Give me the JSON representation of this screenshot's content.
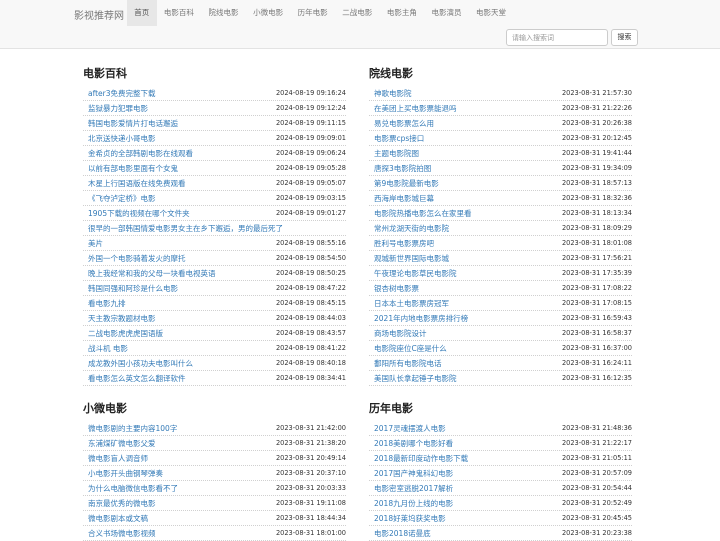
{
  "brand": "影视推荐网",
  "nav": [
    "首页",
    "电影百科",
    "院线电影",
    "小微电影",
    "历年电影",
    "二战电影",
    "电影主角",
    "电影演员",
    "电影天堂"
  ],
  "search": {
    "placeholder": "请输入搜索词",
    "button": "搜索"
  },
  "sections": [
    {
      "title": "电影百科",
      "items": [
        {
          "t": "after3免费完整下载",
          "d": "2024-08-19 09:16:24"
        },
        {
          "t": "监狱暴力犯罪电影",
          "d": "2024-08-19 09:12:24"
        },
        {
          "t": "韩国电影爱情片打电话邂逅",
          "d": "2024-08-19 09:11:15"
        },
        {
          "t": "北京送快递小哥电影",
          "d": "2024-08-19 09:09:01"
        },
        {
          "t": "金希贞的全部韩剧电影在线观看",
          "d": "2024-08-19 09:06:24"
        },
        {
          "t": "以前有部电影里面有个女鬼",
          "d": "2024-08-19 09:05:28"
        },
        {
          "t": "木星上行国语版在线免费观看",
          "d": "2024-08-19 09:05:07"
        },
        {
          "t": "《飞夺泸定桥》电影",
          "d": "2024-08-19 09:03:15"
        },
        {
          "t": "1905下载的视频在哪个文件夹",
          "d": "2024-08-19 09:01:27"
        },
        {
          "t": "很早的一部韩国情爱电影男女主在乡下邂逅，男的最后死了",
          "d": ""
        },
        {
          "t": "美片",
          "d": "2024-08-19 08:55:16"
        },
        {
          "t": "外国一个电影骑着发火的摩托",
          "d": "2024-08-19 08:54:50"
        },
        {
          "t": "晚上我经常和我的父母一块看电视英语",
          "d": "2024-08-19 08:50:25"
        },
        {
          "t": "韩国同强和阿珍是什么电影",
          "d": "2024-08-19 08:47:22"
        },
        {
          "t": "看电影九排",
          "d": "2024-08-19 08:45:15"
        },
        {
          "t": "天主教宗教题材电影",
          "d": "2024-08-19 08:44:03"
        },
        {
          "t": "二战电影虎虎虎国语版",
          "d": "2024-08-19 08:43:57"
        },
        {
          "t": "战斗机 电影",
          "d": "2024-08-19 08:41:22"
        },
        {
          "t": "成龙教外国小孩功夫电影叫什么",
          "d": "2024-08-19 08:40:18"
        },
        {
          "t": "看电影怎么英文怎么翻译软件",
          "d": "2024-08-19 08:34:41"
        }
      ]
    },
    {
      "title": "院线电影",
      "items": [
        {
          "t": "神歌电影院",
          "d": "2023-08-31 21:57:30"
        },
        {
          "t": "在美团上买电影票能退吗",
          "d": "2023-08-31 21:22:26"
        },
        {
          "t": "易兑电影票怎么用",
          "d": "2023-08-31 20:26:38"
        },
        {
          "t": "电影票cps接口",
          "d": "2023-08-31 20:12:45"
        },
        {
          "t": "主题电影院图",
          "d": "2023-08-31 19:41:44"
        },
        {
          "t": "唐探3电影院拍图",
          "d": "2023-08-31 19:34:09"
        },
        {
          "t": "第9电影院最新电影",
          "d": "2023-08-31 18:57:13"
        },
        {
          "t": "西海岸电影城巨幕",
          "d": "2023-08-31 18:32:36"
        },
        {
          "t": "电影院热播电影怎么在家里看",
          "d": "2023-08-31 18:13:34"
        },
        {
          "t": "常州龙湖天街的电影院",
          "d": "2023-08-31 18:09:29"
        },
        {
          "t": "胜利号电影票房吧",
          "d": "2023-08-31 18:01:08"
        },
        {
          "t": "观城新世界国际电影城",
          "d": "2023-08-31 17:56:21"
        },
        {
          "t": "午夜理论电影草民电影院",
          "d": "2023-08-31 17:35:39"
        },
        {
          "t": "银杏树电影票",
          "d": "2023-08-31 17:08:22"
        },
        {
          "t": "日本本土电影票房冠军",
          "d": "2023-08-31 17:08:15"
        },
        {
          "t": "2021年内地电影票房排行榜",
          "d": "2023-08-31 16:59:43"
        },
        {
          "t": "商场电影院设计",
          "d": "2023-08-31 16:58:37"
        },
        {
          "t": "电影院座位C座是什么",
          "d": "2023-08-31 16:37:00"
        },
        {
          "t": "鄱阳所有电影院电话",
          "d": "2023-08-31 16:24:11"
        },
        {
          "t": "美国队长拿起锤子电影院",
          "d": "2023-08-31 16:12:35"
        }
      ]
    },
    {
      "title": "小微电影",
      "items": [
        {
          "t": "微电影剧的主要内容100字",
          "d": "2023-08-31 21:42:00"
        },
        {
          "t": "东浦煤矿微电影父爱",
          "d": "2023-08-31 21:38:20"
        },
        {
          "t": "微电影盲人调音师",
          "d": "2023-08-31 20:49:14"
        },
        {
          "t": "小电影开头曲钢琴弹奏",
          "d": "2023-08-31 20:37:10"
        },
        {
          "t": "为什么电脑微信电影看不了",
          "d": "2023-08-31 20:03:33"
        },
        {
          "t": "南京最优秀的微电影",
          "d": "2023-08-31 19:11:08"
        },
        {
          "t": "微电影剧本或文稿",
          "d": "2023-08-31 18:44:34"
        },
        {
          "t": "合义书场微电影视频",
          "d": "2023-08-31 18:01:00"
        }
      ]
    },
    {
      "title": "历年电影",
      "items": [
        {
          "t": "2017灵魂摆渡人电影",
          "d": "2023-08-31 21:48:36"
        },
        {
          "t": "2018美剧哪个电影好看",
          "d": "2023-08-31 21:22:17"
        },
        {
          "t": "2018最新印度动作电影下载",
          "d": "2023-08-31 21:05:11"
        },
        {
          "t": "2017国产神鬼科幻电影",
          "d": "2023-08-31 20:57:09"
        },
        {
          "t": "电影密室逃脱2017解析",
          "d": "2023-08-31 20:54:44"
        },
        {
          "t": "2018九月份上线的电影",
          "d": "2023-08-31 20:52:49"
        },
        {
          "t": "2018好莱坞获奖电影",
          "d": "2023-08-31 20:45:45"
        },
        {
          "t": "电影2018诺曼底",
          "d": "2023-08-31 20:23:38"
        }
      ]
    }
  ]
}
